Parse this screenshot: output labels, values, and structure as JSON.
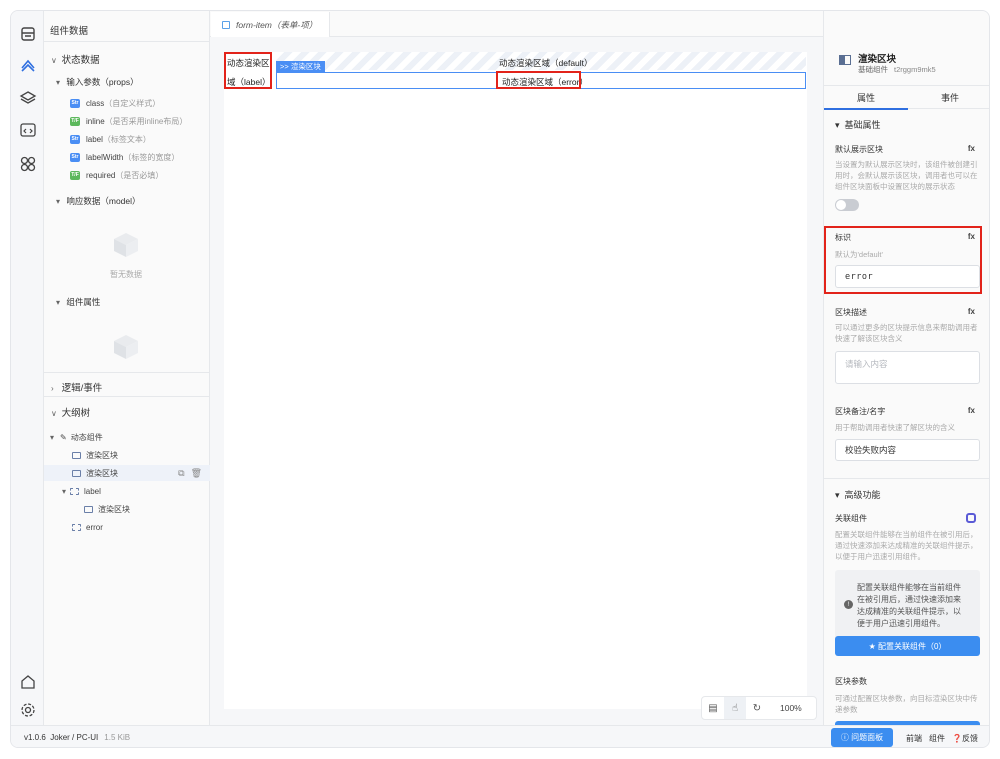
{
  "left_panel": {
    "header": "组件数据",
    "state_section": "状态数据",
    "props_group": "输入参数（props）",
    "props": [
      {
        "type": "Str",
        "name": "class",
        "desc": "（自定义样式）"
      },
      {
        "type": "T/F",
        "name": "inline",
        "desc": "（是否采用inline布局）"
      },
      {
        "type": "Str",
        "name": "label",
        "desc": "（标签文本）"
      },
      {
        "type": "Str",
        "name": "labelWidth",
        "desc": "（标签的宽度）"
      },
      {
        "type": "T/F",
        "name": "required",
        "desc": "（是否必填）"
      }
    ],
    "model_group": "响应数据（model）",
    "empty_text": "暂无数据",
    "component_props_group": "组件属性",
    "logic_section": "逻辑/事件",
    "outline_section": "大纲树",
    "outline": {
      "root": "动态组件",
      "items": [
        "渲染区块",
        "渲染区块",
        "label",
        "渲染区块",
        "error"
      ]
    }
  },
  "tab": {
    "label": "form-item（表单-项）"
  },
  "canvas": {
    "label_top": "动态渲染区",
    "label_bottom": "域（label）",
    "slot_tag": ">> 渲染区块",
    "default_region": "动态渲染区域（default）",
    "error_region": "动态渲染区域（error）"
  },
  "zoom": {
    "level": "100%"
  },
  "right_panel": {
    "title": "渲染区块",
    "subtitle": "基础组件",
    "component_id": "t2rggm9mk5",
    "tabs": [
      "属性",
      "事件"
    ],
    "basic_group": "基础属性",
    "fx": "fx",
    "default_show_label": "默认展示区块",
    "default_show_desc": "当设置为默认展示区块时，该组件被创建引用时，会默认展示该区块，调用者也可以在组件区块面板中设置区块的展示状态",
    "ident_label": "标识",
    "ident_desc": "默认为'default'",
    "ident_value": "error",
    "block_desc_label": "区块描述",
    "block_desc_desc": "可以通过更多的区块提示信息来帮助调用者快速了解该区块含义",
    "block_desc_placeholder": "请输入内容",
    "note_label": "区块备注/名字",
    "note_desc": "用于帮助调用者快速了解区块的含义",
    "note_value": "校验失败内容",
    "advanced_group": "高级功能",
    "link_label": "关联组件",
    "link_desc": "配置关联组件能够在当前组件在被引用后，通过快速添加来达成精准的关联组件提示，以便于用户迅速引用组件。",
    "link_box_text": "配置关联组件能够在当前组件在被引用后，通过快速添加来达成精准的关联组件提示，以便于用户迅速引用组件。",
    "link_button": "★  配置关联组件（0）",
    "params_label": "区块参数",
    "params_desc": "可通过配置区块参数，向目标渲染区块中传递参数"
  },
  "status_bar": {
    "version": "v1.0.6",
    "project": "Joker / PC-UI",
    "size": "1.5 KiB",
    "issue_button": "问题面板",
    "links": [
      "前端",
      "组件",
      "反馈"
    ]
  },
  "colors": {
    "accent": "#3b8df0",
    "highlight": "#e2231a",
    "slot": "#4a8ef4"
  }
}
